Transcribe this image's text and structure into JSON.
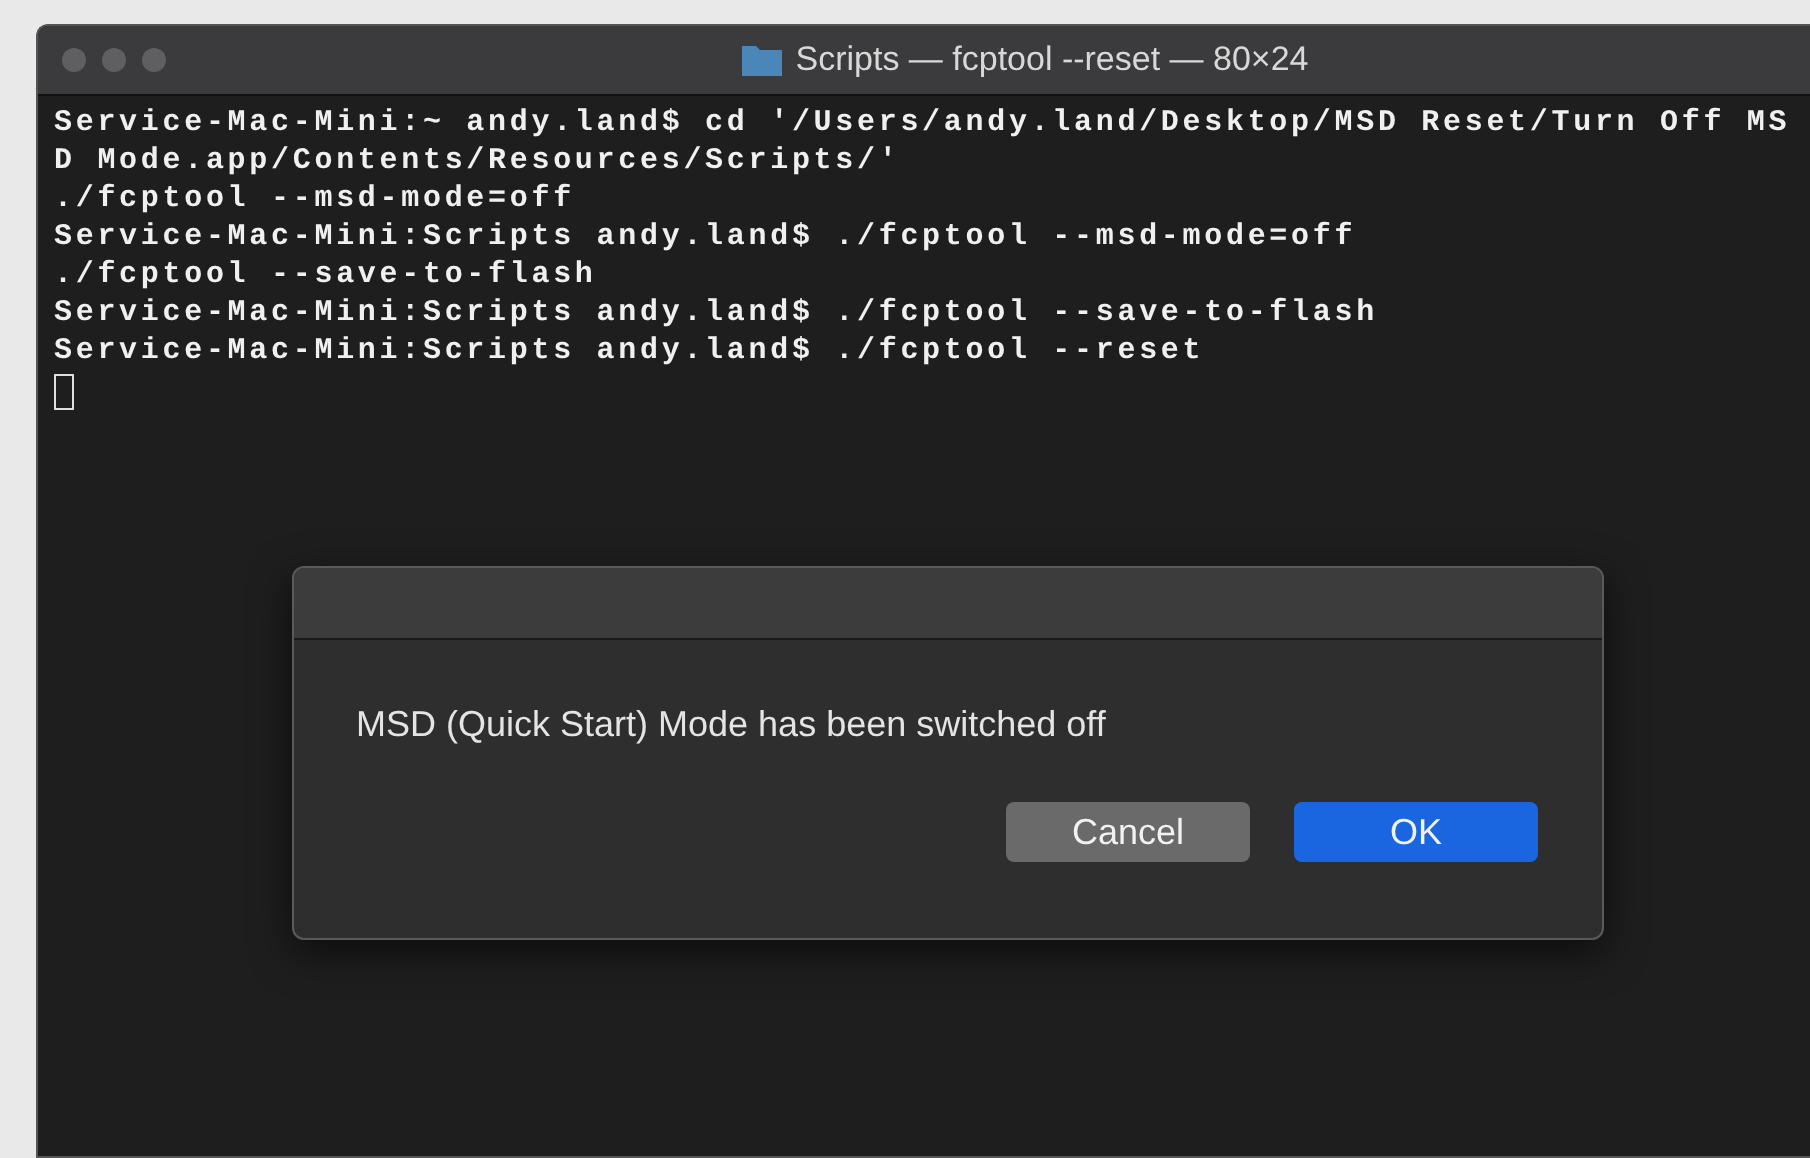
{
  "window": {
    "title": "Scripts — fcptool --reset — 80×24"
  },
  "terminal": {
    "lines": [
      "Service-Mac-Mini:~ andy.land$ cd '/Users/andy.land/Desktop/MSD Reset/Turn Off MS",
      "D Mode.app/Contents/Resources/Scripts/'",
      "./fcptool --msd-mode=off",
      "Service-Mac-Mini:Scripts andy.land$ ./fcptool --msd-mode=off",
      "./fcptool --save-to-flash",
      "Service-Mac-Mini:Scripts andy.land$ ./fcptool --save-to-flash",
      "Service-Mac-Mini:Scripts andy.land$ ./fcptool --reset"
    ]
  },
  "dialog": {
    "message": "MSD (Quick Start) Mode has been switched off",
    "buttons": [
      {
        "label": "Cancel",
        "default": false
      },
      {
        "label": "OK",
        "default": true
      }
    ]
  }
}
